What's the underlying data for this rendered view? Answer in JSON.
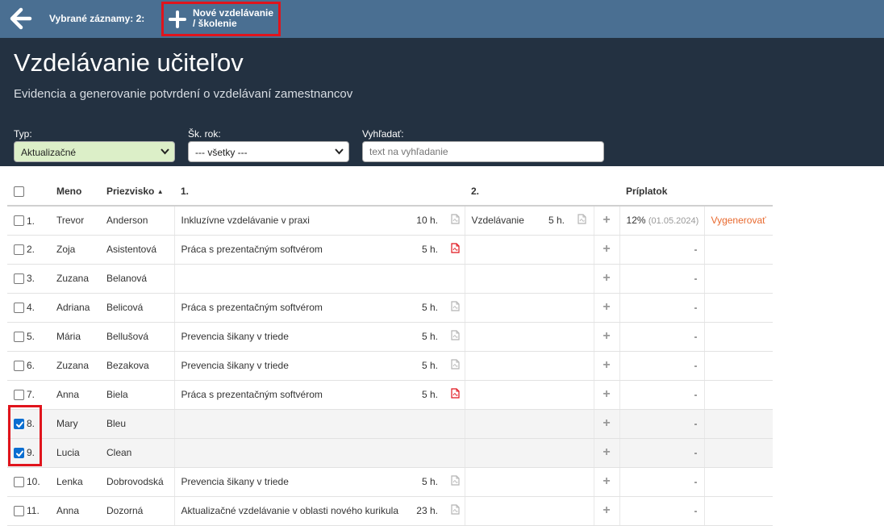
{
  "topbar": {
    "selected_label": "Vybrané záznamy: 2:",
    "new_line1": "Nové vzdelávanie",
    "new_line2": "/ školenie"
  },
  "header": {
    "title": "Vzdelávanie učiteľov",
    "subtitle": "Evidencia a generovanie potvrdení o vzdelávaní zamestnancov"
  },
  "filters": {
    "typ_label": "Typ:",
    "typ_value": "Aktualizačné",
    "rok_label": "Šk. rok:",
    "rok_value": "--- všetky ---",
    "search_label": "Vyhľadať:",
    "search_placeholder": "text na vyhľadanie"
  },
  "columns": {
    "meno": "Meno",
    "priezvisko": "Priezvisko",
    "sort_indicator": "▲",
    "first": "1.",
    "second": "2.",
    "priplatok": "Príplatok"
  },
  "colors": {
    "topbar": "#4a6f92",
    "header": "#233141",
    "highlight": "#e0141c",
    "accent_link": "#e8692e",
    "pdf_red": "#e0141c"
  },
  "rows": [
    {
      "num": "1.",
      "checked": false,
      "meno": "Trevor",
      "priezvisko": "Anderson",
      "e1": "Inkluzívne vzdelávanie v praxi",
      "h1": "10 h.",
      "pdf1": "grey",
      "e2": "Vzdelávanie",
      "h2": "5 h.",
      "pdf2": "grey",
      "plus": "+",
      "pct": "12%",
      "date": "(01.05.2024)",
      "action": "Vygenerovať"
    },
    {
      "num": "2.",
      "checked": false,
      "meno": "Zoja",
      "priezvisko": "Asistentová",
      "e1": "Práca s prezentačným softvérom",
      "h1": "5 h.",
      "pdf1": "red",
      "plus": "+",
      "pct": "-"
    },
    {
      "num": "3.",
      "checked": false,
      "meno": "Zuzana",
      "priezvisko": "Belanová",
      "plus": "+",
      "pct": "-"
    },
    {
      "num": "4.",
      "checked": false,
      "meno": "Adriana",
      "priezvisko": "Belicová",
      "e1": "Práca s prezentačným softvérom",
      "h1": "5 h.",
      "pdf1": "grey",
      "plus": "+",
      "pct": "-"
    },
    {
      "num": "5.",
      "checked": false,
      "meno": "Mária",
      "priezvisko": "Bellušová",
      "e1": "Prevencia šikany v triede",
      "h1": "5 h.",
      "pdf1": "grey",
      "plus": "+",
      "pct": "-"
    },
    {
      "num": "6.",
      "checked": false,
      "meno": "Zuzana",
      "priezvisko": "Bezakova",
      "e1": "Prevencia šikany v triede",
      "h1": "5 h.",
      "pdf1": "grey",
      "plus": "+",
      "pct": "-"
    },
    {
      "num": "7.",
      "checked": false,
      "meno": "Anna",
      "priezvisko": "Biela",
      "e1": "Práca s prezentačným softvérom",
      "h1": "5 h.",
      "pdf1": "red",
      "plus": "+",
      "pct": "-"
    },
    {
      "num": "8.",
      "checked": true,
      "meno": "Mary",
      "priezvisko": "Bleu",
      "plus": "+",
      "pct": "-"
    },
    {
      "num": "9.",
      "checked": true,
      "meno": "Lucia",
      "priezvisko": "Clean",
      "plus": "+",
      "pct": "-"
    },
    {
      "num": "10.",
      "checked": false,
      "meno": "Lenka",
      "priezvisko": "Dobrovodská",
      "e1": "Prevencia šikany v triede",
      "h1": "5 h.",
      "pdf1": "grey",
      "plus": "+",
      "pct": "-"
    },
    {
      "num": "11.",
      "checked": false,
      "meno": "Anna",
      "priezvisko": "Dozorná",
      "e1": "Aktualizačné vzdelávanie v oblasti nového kurikula",
      "h1": "23 h.",
      "pdf1": "grey",
      "plus": "+",
      "pct": "-"
    }
  ]
}
